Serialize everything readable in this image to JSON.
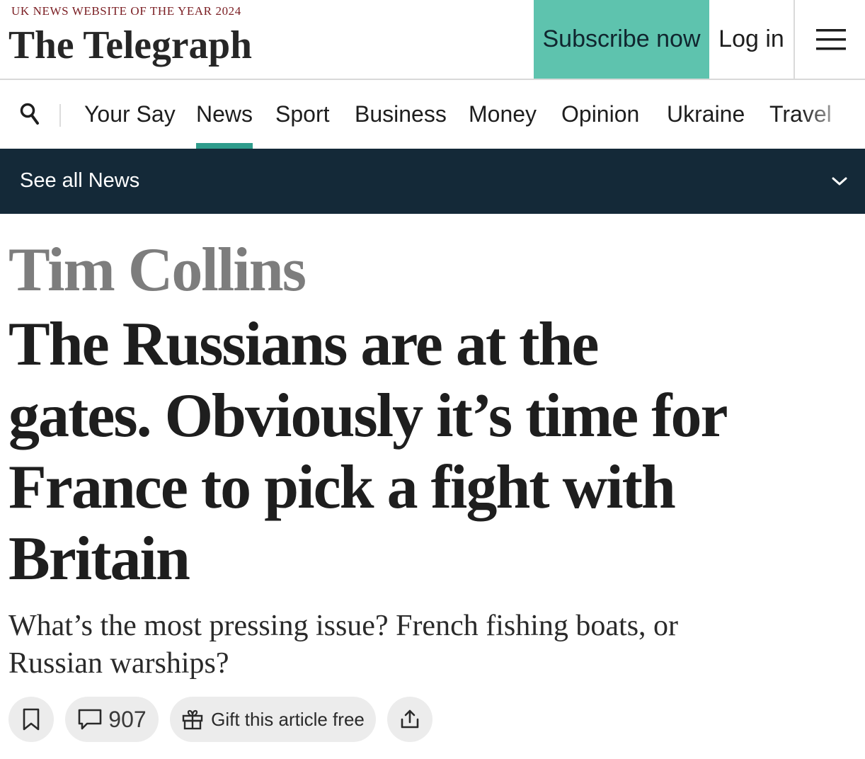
{
  "masthead": {
    "award_text": "UK NEWS WEBSITE OF THE YEAR 2024",
    "logo_text": "The Telegraph",
    "subscribe_label": "Subscribe now",
    "login_label": "Log in",
    "menu_icon": "hamburger-menu-icon"
  },
  "nav": {
    "search_icon": "search-icon",
    "items": [
      {
        "label": "Your Say"
      },
      {
        "label": "News",
        "active": true
      },
      {
        "label": "Sport"
      },
      {
        "label": "Business"
      },
      {
        "label": "Money"
      },
      {
        "label": "Opinion"
      },
      {
        "label": "Ukraine"
      },
      {
        "label": "Travel"
      }
    ]
  },
  "section_bar": {
    "label": "See all News",
    "chevron_icon": "chevron-down-icon"
  },
  "article": {
    "author": "Tim Collins",
    "headline_lines": [
      "The Russians are at the",
      "gates. Obviously it’s time for",
      "France to pick a fight with",
      "Britain"
    ],
    "standfirst_lines": [
      "What’s the most pressing issue? French fishing boats, or",
      "Russian warships?"
    ]
  },
  "actions": {
    "save_icon": "bookmark-icon",
    "comments_icon": "comment-icon",
    "comment_count": "907",
    "gift_icon": "gift-icon",
    "gift_label": "Gift this article free",
    "share_icon": "share-icon"
  },
  "colors": {
    "subscribe_bg": "#5ec3ae",
    "section_bar_bg": "#142938",
    "nav_active_underline": "#2f9c8c",
    "award_text": "#7a1d22",
    "author_text": "#7d7d7d",
    "pill_bg": "#ececec"
  }
}
